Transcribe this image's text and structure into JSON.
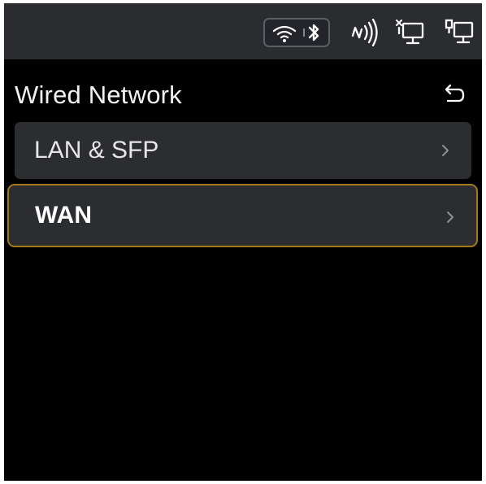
{
  "header": {
    "title": "Wired Network",
    "back_icon": "back-arrow-icon"
  },
  "status_bar": {
    "icons": [
      "wifi-icon",
      "bluetooth-icon",
      "nfc-icon",
      "network-port-disconnected-icon",
      "network-port-connected-icon"
    ]
  },
  "menu": {
    "items": [
      {
        "label": "LAN & SFP",
        "selected": false,
        "icon": "chevron-right-icon"
      },
      {
        "label": "WAN",
        "selected": true,
        "icon": "chevron-right-icon"
      }
    ]
  },
  "colors": {
    "background": "#000000",
    "status_bar": "#2a2c2f",
    "item_background": "#2b2d30",
    "selected_border": "#a27a1c",
    "text": "#f2f2f2"
  }
}
